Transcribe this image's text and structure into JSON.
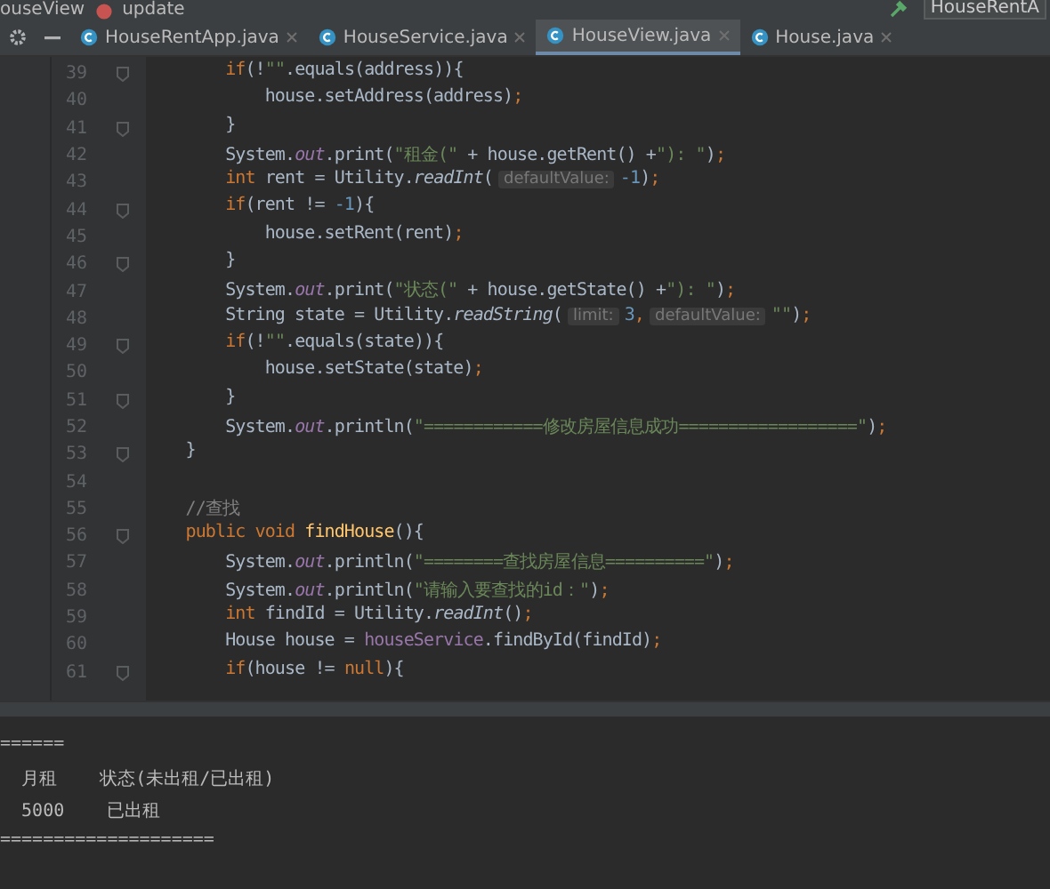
{
  "breadcrumb": {
    "items": [
      {
        "text": "ouseView"
      },
      {
        "text": "update"
      }
    ],
    "run_config": "HouseRentA"
  },
  "tabs": [
    {
      "label": "HouseRentApp.java",
      "selected": false
    },
    {
      "label": "HouseService.java",
      "selected": false
    },
    {
      "label": "HouseView.java",
      "selected": true
    },
    {
      "label": "House.java",
      "selected": false
    }
  ],
  "editor": {
    "lines": [
      {
        "number": "39",
        "fold": true,
        "tokens": [
          {
            "kind": "keyword",
            "text": "        if"
          },
          {
            "kind": "plain",
            "text": "(!"
          },
          {
            "kind": "string",
            "text": "\"\""
          },
          {
            "kind": "plain",
            "text": ".equals(address)){"
          }
        ]
      },
      {
        "number": "40",
        "fold": false,
        "tokens": [
          {
            "kind": "plain",
            "text": "            house.setAddress(address)"
          },
          {
            "kind": "keyword",
            "text": ";"
          }
        ]
      },
      {
        "number": "41",
        "fold": true,
        "tokens": [
          {
            "kind": "plain",
            "text": "        }"
          }
        ]
      },
      {
        "number": "42",
        "fold": false,
        "tokens": [
          {
            "kind": "plain",
            "text": "        System."
          },
          {
            "kind": "field",
            "text": "out"
          },
          {
            "kind": "plain",
            "text": ".print("
          },
          {
            "kind": "string",
            "text": "\"租金(\""
          },
          {
            "kind": "plain",
            "text": " + house.getRent() +"
          },
          {
            "kind": "string",
            "text": "\"): \""
          },
          {
            "kind": "plain",
            "text": ")"
          },
          {
            "kind": "keyword",
            "text": ";"
          }
        ]
      },
      {
        "number": "43",
        "fold": false,
        "tokens": [
          {
            "kind": "keyword",
            "text": "        int"
          },
          {
            "kind": "plain",
            "text": " rent = Utility."
          },
          {
            "kind": "static",
            "text": "readInt"
          },
          {
            "kind": "plain",
            "text": "("
          },
          {
            "kind": "hint",
            "text": "defaultValue:"
          },
          {
            "kind": "number",
            "text": "-1"
          },
          {
            "kind": "plain",
            "text": ")"
          },
          {
            "kind": "keyword",
            "text": ";"
          }
        ]
      },
      {
        "number": "44",
        "fold": true,
        "tokens": [
          {
            "kind": "keyword",
            "text": "        if"
          },
          {
            "kind": "plain",
            "text": "(rent != "
          },
          {
            "kind": "number",
            "text": "-1"
          },
          {
            "kind": "plain",
            "text": "){"
          }
        ]
      },
      {
        "number": "45",
        "fold": false,
        "tokens": [
          {
            "kind": "plain",
            "text": "            house.setRent(rent)"
          },
          {
            "kind": "keyword",
            "text": ";"
          }
        ]
      },
      {
        "number": "46",
        "fold": true,
        "tokens": [
          {
            "kind": "plain",
            "text": "        }"
          }
        ]
      },
      {
        "number": "47",
        "fold": false,
        "tokens": [
          {
            "kind": "plain",
            "text": "        System."
          },
          {
            "kind": "field",
            "text": "out"
          },
          {
            "kind": "plain",
            "text": ".print("
          },
          {
            "kind": "string",
            "text": "\"状态(\""
          },
          {
            "kind": "plain",
            "text": " + house.getState() +"
          },
          {
            "kind": "string",
            "text": "\"): \""
          },
          {
            "kind": "plain",
            "text": ")"
          },
          {
            "kind": "keyword",
            "text": ";"
          }
        ]
      },
      {
        "number": "48",
        "fold": false,
        "tokens": [
          {
            "kind": "plain",
            "text": "        String state = Utility."
          },
          {
            "kind": "static",
            "text": "readString"
          },
          {
            "kind": "plain",
            "text": "("
          },
          {
            "kind": "hint",
            "text": "limit:"
          },
          {
            "kind": "number",
            "text": "3"
          },
          {
            "kind": "keyword",
            "text": ","
          },
          {
            "kind": "hint",
            "text": "defaultValue:"
          },
          {
            "kind": "string",
            "text": "\"\""
          },
          {
            "kind": "plain",
            "text": ")"
          },
          {
            "kind": "keyword",
            "text": ";"
          }
        ]
      },
      {
        "number": "49",
        "fold": true,
        "tokens": [
          {
            "kind": "keyword",
            "text": "        if"
          },
          {
            "kind": "plain",
            "text": "(!"
          },
          {
            "kind": "string",
            "text": "\"\""
          },
          {
            "kind": "plain",
            "text": ".equals(state)){"
          }
        ]
      },
      {
        "number": "50",
        "fold": false,
        "tokens": [
          {
            "kind": "plain",
            "text": "            house.setState(state)"
          },
          {
            "kind": "keyword",
            "text": ";"
          }
        ]
      },
      {
        "number": "51",
        "fold": true,
        "tokens": [
          {
            "kind": "plain",
            "text": "        }"
          }
        ]
      },
      {
        "number": "52",
        "fold": false,
        "tokens": [
          {
            "kind": "plain",
            "text": "        System."
          },
          {
            "kind": "field",
            "text": "out"
          },
          {
            "kind": "plain",
            "text": ".println("
          },
          {
            "kind": "string",
            "text": "\"============修改房屋信息成功==================\""
          },
          {
            "kind": "plain",
            "text": ")"
          },
          {
            "kind": "keyword",
            "text": ";"
          }
        ]
      },
      {
        "number": "53",
        "fold": true,
        "tokens": [
          {
            "kind": "plain",
            "text": "    }"
          }
        ]
      },
      {
        "number": "54",
        "fold": false
      },
      {
        "number": "55",
        "fold": false,
        "tokens": [
          {
            "kind": "comment",
            "text": "    //查找"
          }
        ]
      },
      {
        "number": "56",
        "fold": true,
        "tokens": [
          {
            "kind": "keyword",
            "text": "    public void "
          },
          {
            "kind": "declaration",
            "text": "findHouse"
          },
          {
            "kind": "plain",
            "text": "(){"
          }
        ]
      },
      {
        "number": "57",
        "fold": false,
        "tokens": [
          {
            "kind": "plain",
            "text": "        System."
          },
          {
            "kind": "field",
            "text": "out"
          },
          {
            "kind": "plain",
            "text": ".println("
          },
          {
            "kind": "string",
            "text": "\"========查找房屋信息==========\""
          },
          {
            "kind": "plain",
            "text": ")"
          },
          {
            "kind": "keyword",
            "text": ";"
          }
        ]
      },
      {
        "number": "58",
        "fold": false,
        "tokens": [
          {
            "kind": "plain",
            "text": "        System."
          },
          {
            "kind": "field",
            "text": "out"
          },
          {
            "kind": "plain",
            "text": ".println("
          },
          {
            "kind": "string",
            "text": "\"请输入要查找的id：\""
          },
          {
            "kind": "plain",
            "text": ")"
          },
          {
            "kind": "keyword",
            "text": ";"
          }
        ]
      },
      {
        "number": "59",
        "fold": false,
        "tokens": [
          {
            "kind": "keyword",
            "text": "        int"
          },
          {
            "kind": "plain",
            "text": " findId = Utility."
          },
          {
            "kind": "static",
            "text": "readInt"
          },
          {
            "kind": "plain",
            "text": "()"
          },
          {
            "kind": "keyword",
            "text": ";"
          }
        ]
      },
      {
        "number": "60",
        "fold": false,
        "tokens": [
          {
            "kind": "plain",
            "text": "        House house = "
          },
          {
            "kind": "member",
            "text": "houseService"
          },
          {
            "kind": "plain",
            "text": ".findById(findId)"
          },
          {
            "kind": "keyword",
            "text": ";"
          }
        ]
      },
      {
        "number": "61",
        "fold": true,
        "tokens": [
          {
            "kind": "keyword",
            "text": "        if"
          },
          {
            "kind": "plain",
            "text": "(house != "
          },
          {
            "kind": "keyword",
            "text": "null"
          },
          {
            "kind": "plain",
            "text": "){"
          }
        ]
      }
    ]
  },
  "console": {
    "lines": [
      "======",
      "  月租    状态(未出租/已出租)",
      "  5000    已出租",
      "===================="
    ]
  }
}
